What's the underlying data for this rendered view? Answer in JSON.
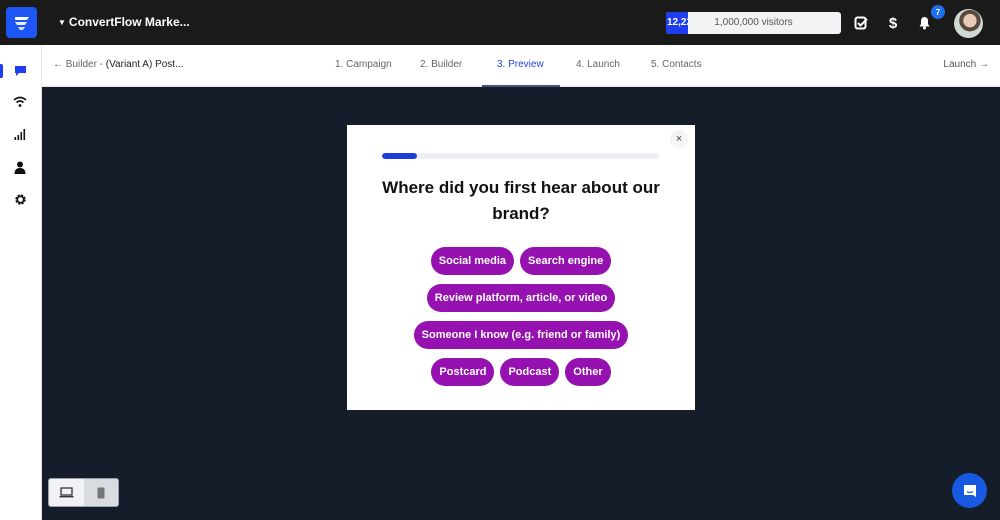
{
  "topbar": {
    "account_name": "ConvertFlow Marke...",
    "account_caret_icon": "caret-down-icon",
    "visitors": {
      "used_label": "12,22",
      "limit_label": "1,000,000 visitors",
      "fill_fraction": 0.126
    },
    "icons": [
      "checklist-icon",
      "dollar-icon",
      "bell-icon"
    ],
    "notifications_count": "7",
    "colors": {
      "background": "#1a1a1a",
      "brand": "#1e56f5",
      "visitor_fill": "#1e3ef0",
      "badge": "#1e6ff0"
    }
  },
  "sidebar": {
    "items": [
      {
        "name": "messages",
        "icon": "chat-bubble-icon",
        "active": true
      },
      {
        "name": "broadcasts",
        "icon": "wifi-icon",
        "active": false
      },
      {
        "name": "analytics",
        "icon": "bar-chart-icon",
        "active": false
      },
      {
        "name": "contacts",
        "icon": "person-icon",
        "active": false
      },
      {
        "name": "settings",
        "icon": "gear-icon",
        "active": false
      }
    ]
  },
  "subnav": {
    "back_prefix": "← Builder - ",
    "back_name": "(Variant A) Post...",
    "steps": [
      {
        "label": "1. Campaign",
        "active": false
      },
      {
        "label": "2. Builder",
        "active": false
      },
      {
        "label": "3. Preview",
        "active": true
      },
      {
        "label": "4. Launch",
        "active": false
      },
      {
        "label": "5. Contacts",
        "active": false
      }
    ],
    "launch_label": "Launch →",
    "active_color": "#2444d8"
  },
  "modal": {
    "close_label": "×",
    "progress_fraction": 0.125,
    "question": "Where did you first hear about our brand?",
    "option_rows": [
      [
        "Social media",
        "Search engine"
      ],
      [
        "Review platform, article, or video"
      ],
      [
        "Someone I know (e.g. friend or family)"
      ],
      [
        "Postcard",
        "Podcast",
        "Other"
      ]
    ],
    "option_color": "#9512b0",
    "progress_color": "#1e3ed8"
  },
  "device_toggle": {
    "options": [
      {
        "name": "desktop",
        "icon": "laptop-icon",
        "active": true
      },
      {
        "name": "mobile",
        "icon": "phone-icon",
        "active": false
      }
    ]
  },
  "chat_widget": {
    "icon": "chat-icon",
    "color": "#1759e0"
  }
}
